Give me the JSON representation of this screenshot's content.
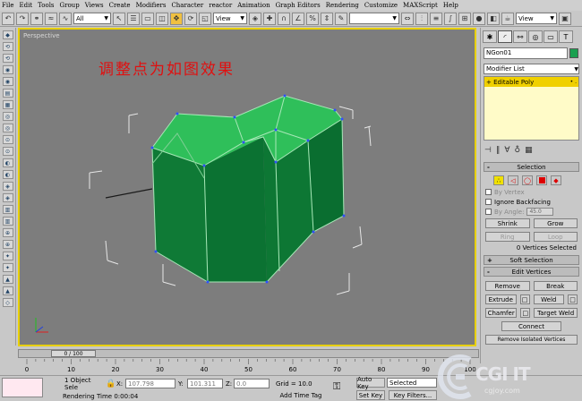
{
  "menu": [
    "File",
    "Edit",
    "Tools",
    "Group",
    "Views",
    "Create",
    "Modifiers",
    "Character",
    "reactor",
    "Animation",
    "Graph Editors",
    "Rendering",
    "Customize",
    "MAXScript",
    "Help"
  ],
  "toolbar": {
    "filter_value": "All",
    "refcoord_value": "View",
    "view_value": "View"
  },
  "viewport": {
    "label": "Perspective",
    "caption": "调整点为如图效果",
    "colors": {
      "border": "#e8d000",
      "top_face": "#2fbf5a",
      "side_face": "#0d7a35",
      "edge": "#a8e8b8"
    }
  },
  "panel": {
    "object_name": "NGon01",
    "object_color": "#1aa050",
    "modifier_list": "Modifier List",
    "stack_item": "Editable Poly",
    "selection_header": "Selection",
    "by_vertex": "By Vertex",
    "ignore_backfacing": "Ignore Backfacing",
    "by_angle": "By Angle:",
    "angle_value": "45.0",
    "shrink": "Shrink",
    "grow": "Grow",
    "ring": "Ring",
    "loop": "Loop",
    "selection_status": "0 Vertices Selected",
    "soft_selection_header": "Soft Selection",
    "edit_vertices_header": "Edit Vertices",
    "remove": "Remove",
    "break": "Break",
    "extrude": "Extrude",
    "weld": "Weld",
    "chamfer": "Chamfer",
    "target_weld": "Target Weld",
    "connect": "Connect",
    "remove_isolated": "Remove Isolated Vertices"
  },
  "timeline": {
    "frame": "0 / 100",
    "ticks": [
      "0",
      "10",
      "20",
      "30",
      "40",
      "50",
      "60",
      "70",
      "80",
      "90",
      "100"
    ]
  },
  "status": {
    "selection": "1 Object Sele",
    "x_label": "X:",
    "x_value": "107.798",
    "y_label": "Y:",
    "y_value": "101.311",
    "z_label": "Z:",
    "z_value": "0.0",
    "grid": "Grid = 10.0",
    "auto_key": "Auto Key",
    "set_key": "Set Key",
    "selected": "Selected",
    "key_filters": "Key Filters...",
    "rendering_time": "Rendering Time  0:00:04",
    "add_time_tag": "Add Time Tag"
  },
  "watermark": {
    "main": "CGI IT",
    "sub": "cgjoy.com"
  }
}
